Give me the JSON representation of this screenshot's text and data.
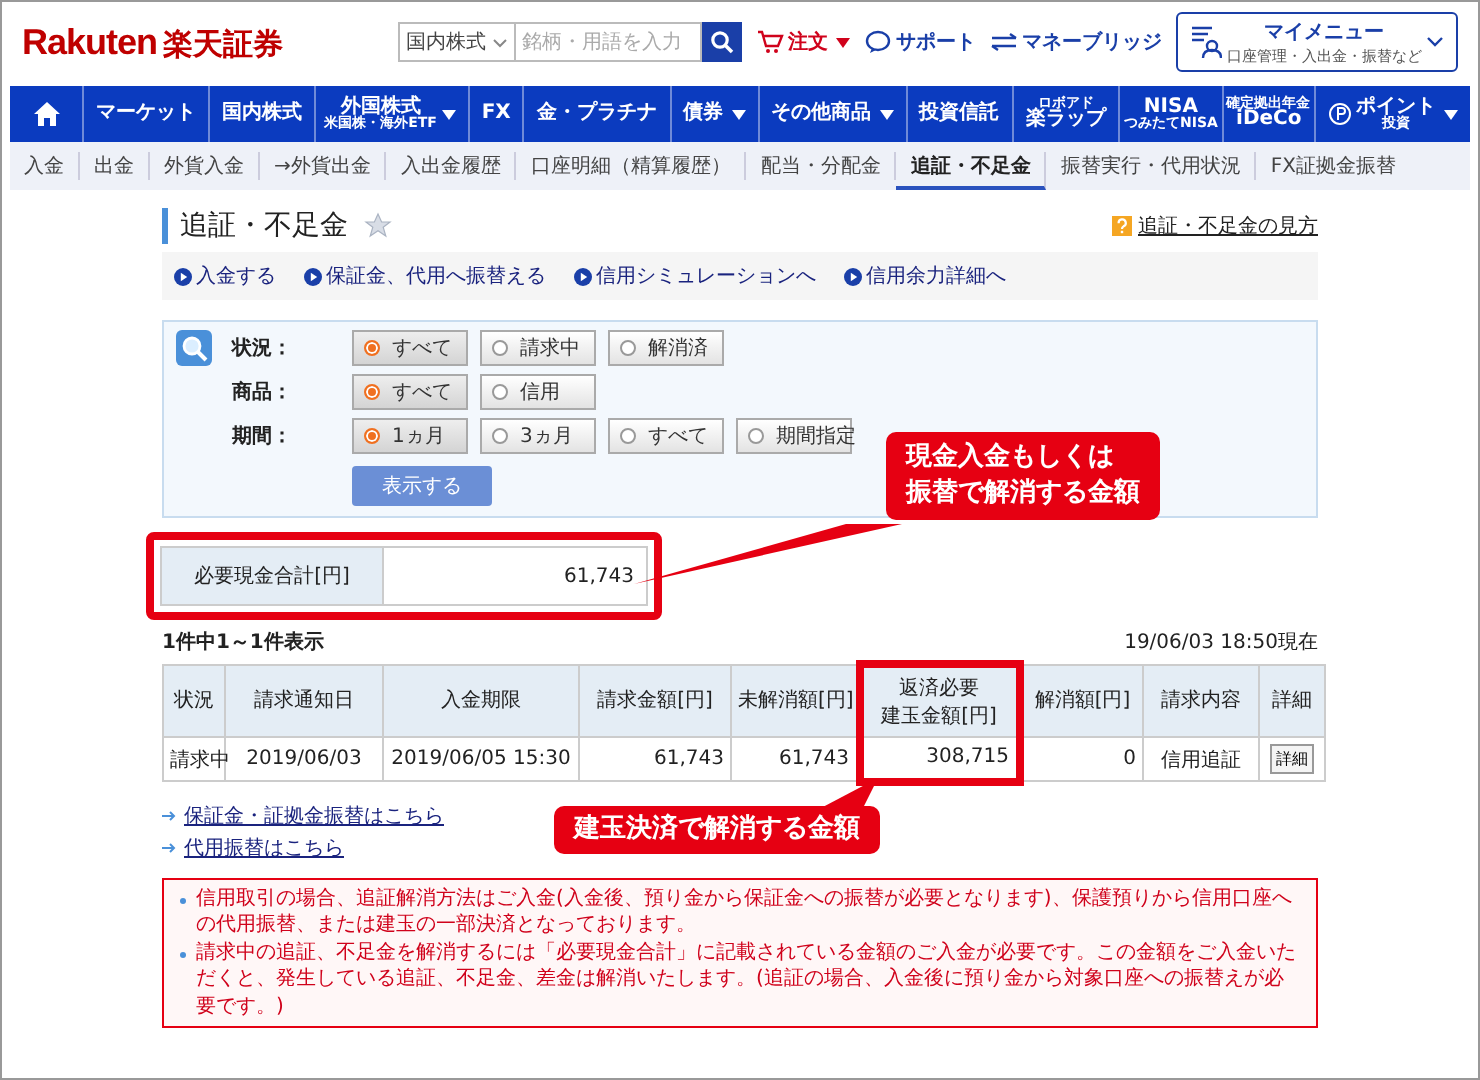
{
  "header": {
    "logo_en": "Rakuten",
    "logo_ja": "楽天証券",
    "search_category": "国内株式",
    "search_placeholder": "銘柄・用語を入力",
    "links": [
      {
        "kind": "cart",
        "label": "注文",
        "caret": true
      },
      {
        "kind": "support",
        "label": "サポート",
        "caret": false
      },
      {
        "kind": "bank",
        "label": "マネーブリッジ",
        "caret": false
      }
    ],
    "mymenu": {
      "title": "マイメニュー",
      "subtitle": "口座管理・入出金・振替など"
    }
  },
  "nav": [
    {
      "kind": "home",
      "caret": false
    },
    {
      "kind": "text",
      "label": "マーケット",
      "caret": false
    },
    {
      "kind": "text",
      "label": "国内株式",
      "caret": false
    },
    {
      "kind": "text",
      "label": "外国株式",
      "sub": "米国株・海外ETF",
      "caret": true
    },
    {
      "kind": "text",
      "label": "FX",
      "caret": false
    },
    {
      "kind": "text",
      "label": "金・プラチナ",
      "caret": false
    },
    {
      "kind": "text",
      "label": "債券",
      "caret": true
    },
    {
      "kind": "text",
      "label": "その他商品",
      "caret": true
    },
    {
      "kind": "text",
      "label": "投資信託",
      "caret": false
    },
    {
      "kind": "text",
      "top": "ロボアド",
      "label": "楽ラップ",
      "caret": false
    },
    {
      "kind": "text",
      "label": "NISA",
      "sub": "つみたてNISA",
      "caret": false
    },
    {
      "kind": "text",
      "top": "確定拠出年金",
      "label": "iDeCo",
      "caret": false
    },
    {
      "kind": "point",
      "label": "ポイント",
      "sub": "投資",
      "caret": true
    }
  ],
  "subnav": [
    {
      "label": "入金",
      "selected": false
    },
    {
      "label": "出金",
      "selected": false
    },
    {
      "label": "外貨入金",
      "selected": false
    },
    {
      "label": "→外貨出金",
      "selected": false
    },
    {
      "label": "入出金履歴",
      "selected": false
    },
    {
      "label": "口座明細（精算履歴）",
      "selected": false
    },
    {
      "label": "配当・分配金",
      "selected": false
    },
    {
      "label": "追証・不足金",
      "selected": true
    },
    {
      "label": "振替実行・代用状況",
      "selected": false
    },
    {
      "label": "FX証拠金振替",
      "selected": false
    }
  ],
  "page_title": "追証・不足金",
  "favorite": false,
  "help_link": "追証・不足金の見方",
  "quick_links": [
    "入金する",
    "保証金、代用へ振替える",
    "信用シミュレーションへ",
    "信用余力詳細へ"
  ],
  "filter": {
    "rows": [
      {
        "label": "状況：",
        "options": [
          {
            "label": "すべて",
            "selected": true
          },
          {
            "label": "請求中",
            "selected": false
          },
          {
            "label": "解消済",
            "selected": false
          }
        ]
      },
      {
        "label": "商品：",
        "options": [
          {
            "label": "すべて",
            "selected": true
          },
          {
            "label": "信用",
            "selected": false
          }
        ]
      },
      {
        "label": "期間：",
        "options": [
          {
            "label": "1ヵ月",
            "selected": true
          },
          {
            "label": "3ヵ月",
            "selected": false
          },
          {
            "label": "すべて",
            "selected": false
          },
          {
            "label": "期間指定",
            "selected": false
          }
        ]
      }
    ],
    "submit": "表示する"
  },
  "summary": {
    "label": "必要現金合計[円]",
    "value": "61,743",
    "highlighted": true
  },
  "count": "1件中1～1件表示",
  "timestamp": "19/06/03 18:50現在",
  "table": {
    "columns": [
      {
        "lines": [
          "状況"
        ],
        "highlighted": false
      },
      {
        "lines": [
          "請求通知日"
        ],
        "highlighted": false
      },
      {
        "lines": [
          "入金期限"
        ],
        "highlighted": false
      },
      {
        "lines": [
          "請求金額[円]"
        ],
        "highlighted": false
      },
      {
        "lines": [
          "未解消額[円]"
        ],
        "highlighted": false
      },
      {
        "lines": [
          "返済必要",
          "建玉金額[円]"
        ],
        "highlighted": true
      },
      {
        "lines": [
          "解消額[円]"
        ],
        "highlighted": false
      },
      {
        "lines": [
          "請求内容"
        ],
        "highlighted": false
      },
      {
        "lines": [
          "詳細"
        ],
        "highlighted": false
      }
    ],
    "rows": [
      {
        "cells": [
          "請求中",
          "2019/06/03",
          "2019/06/05  15:30",
          "61,743",
          "61,743",
          "308,715",
          "0",
          "信用追証"
        ],
        "detail": "詳細"
      }
    ]
  },
  "links": [
    "保証金・証拠金振替はこちら",
    "代用振替はこちら"
  ],
  "notes": [
    "信用取引の場合、追証解消方法はご入金(入金後、預り金から保証金への振替が必要となります)、保護預りから信用口座への代用振替、または建玉の一部決済となっております。",
    "請求中の追証、不足金を解消するには「必要現金合計」に記載されている金額のご入金が必要です。この金額をご入金いただくと、発生している追証、不足金、差金は解消いたします。(追証の場合、入金後に預り金から対象口座への振替えが必要です。)"
  ],
  "callouts": [
    {
      "lines": [
        "現金入金もしくは",
        "振替で解消する金額"
      ]
    },
    {
      "lines": [
        "建玉決済で解消する金額"
      ]
    }
  ]
}
